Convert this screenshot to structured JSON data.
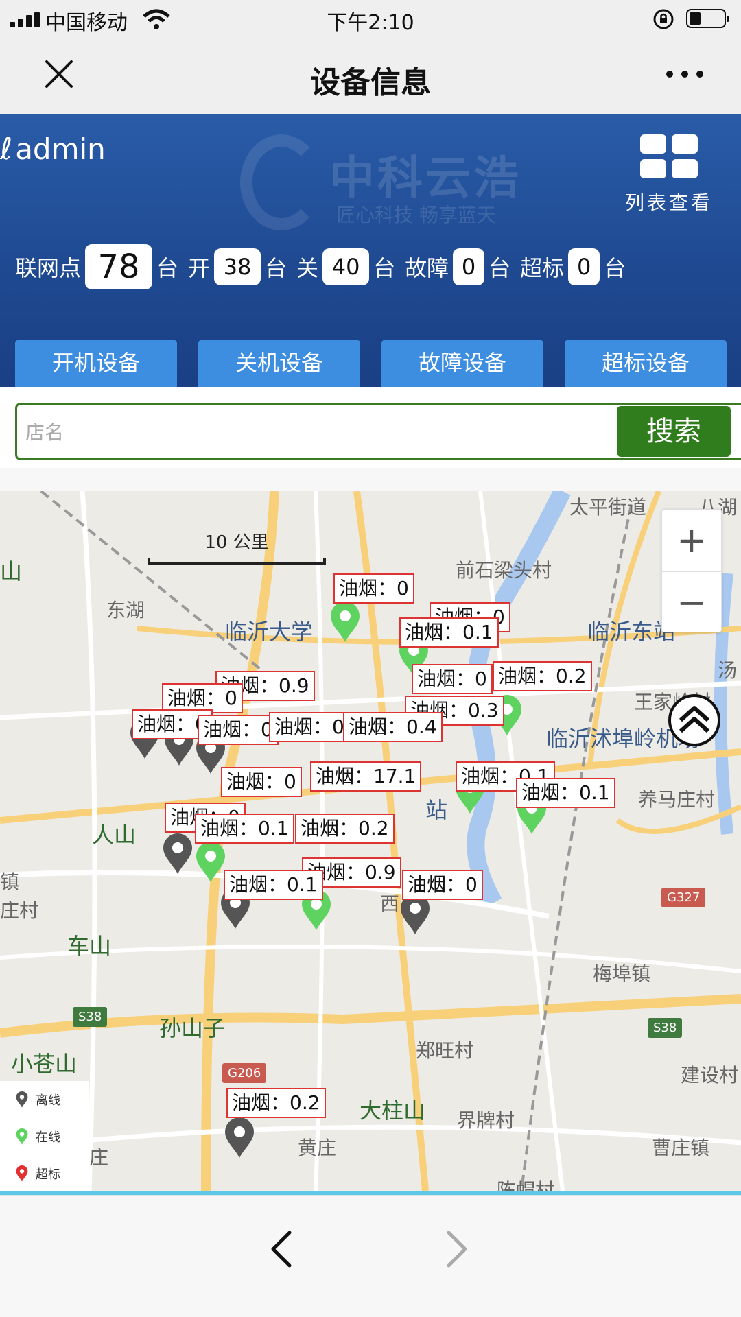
{
  "status_bar": {
    "carrier": "中国移动",
    "time": "下午2:10"
  },
  "nav": {
    "title": "设备信息",
    "close_icon": "close-icon",
    "more_icon": "more-icon"
  },
  "header": {
    "user": "admin",
    "watermark_title": "中科云浩",
    "watermark_slogan": "匠心科技 畅享蓝天",
    "list_view_label": "列表查看",
    "colors": {
      "banner": "#1f4a92",
      "tab": "#3d8de0"
    }
  },
  "stats": {
    "networked_label": "联网点",
    "networked_value": "78",
    "unit": "台",
    "on_label": "开",
    "on_value": "38",
    "off_label": "关",
    "off_value": "40",
    "fault_label": "故障",
    "fault_value": "0",
    "over_label": "超标",
    "over_value": "0"
  },
  "tabs": [
    "开机设备",
    "关机设备",
    "故障设备",
    "超标设备"
  ],
  "search": {
    "placeholder": "店名",
    "button": "搜索",
    "color": "#2f7d1c"
  },
  "map": {
    "scale": "10 公里",
    "zoom_in": "+",
    "zoom_out": "−",
    "places": {
      "p1": "太平街道",
      "p2": "八湖",
      "p3": "前石梁头村",
      "p4": "临沂东站",
      "p5": "东湖",
      "p6": "临沂大学",
      "p7": "王家岭村",
      "p8": "汤",
      "p9": "临沂沭埠岭机场",
      "p10": "养马庄村",
      "p11": "人山",
      "p12": "站",
      "p13": "车山",
      "p14": "梅埠镇",
      "p15": "孙山子",
      "p16": "小苍山",
      "p17": "郑旺村",
      "p18": "建设村",
      "p19": "大柱山",
      "p20": "界牌村",
      "p21": "黄庄",
      "p22": "曹庄镇",
      "p23": "庄",
      "p24": "陈帽村",
      "p25": "山",
      "p26": "镇",
      "p27": "庄村",
      "p28": "西"
    },
    "road_signs": {
      "g327": "G327",
      "s38a": "S38",
      "s38b": "S38",
      "g206": "G206"
    },
    "labels": [
      "油烟：0",
      "油烟：0",
      "油烟：0.1",
      "油烟：0",
      "油烟：0.2",
      "油烟：0.3",
      "油烟：0.9",
      "油烟：0",
      "油烟：0",
      "油烟：0",
      "油烟：0",
      "油烟：0",
      "油烟：0.4",
      "油烟：17.1",
      "油烟：0.1",
      "油烟：0",
      "油烟：0.1",
      "油烟：0.1",
      "油烟：0.2",
      "油烟：0.9",
      "油烟：0.1",
      "油烟：0",
      "油烟：0.2"
    ],
    "legend": {
      "offline": "离线",
      "online": "在线",
      "over": "超标"
    },
    "legend_colors": {
      "offline": "#555555",
      "online": "#5fd35f",
      "over": "#e03030"
    }
  },
  "bottom_nav": {
    "back_icon": "chevron-left-icon",
    "forward_icon": "chevron-right-icon"
  }
}
